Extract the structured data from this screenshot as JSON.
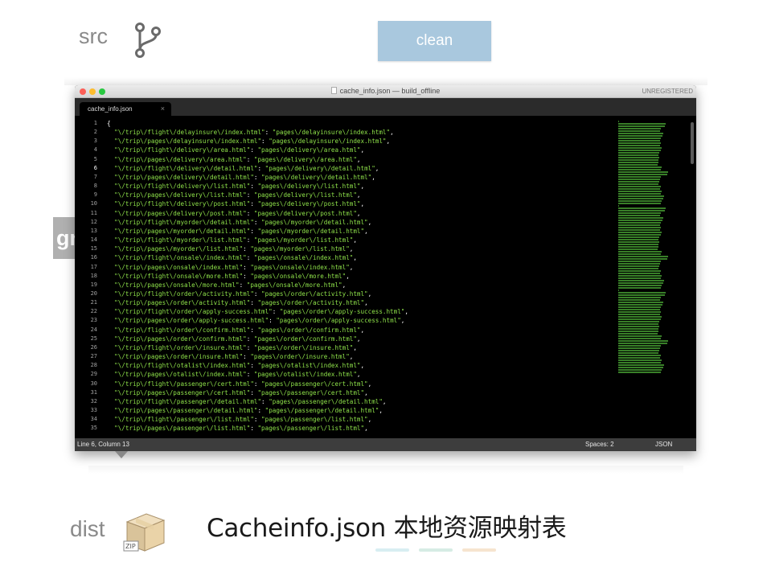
{
  "labels": {
    "src": "src",
    "dist": "dist",
    "gr_tab": "gr"
  },
  "clean_button": {
    "label": "clean"
  },
  "window": {
    "title": "cache_info.json — build_offline",
    "unregistered": "UNREGISTERED",
    "tab": "cache_info.json",
    "tab_close": "×",
    "status_position": "Line 6, Column 13",
    "status_spaces": "Spaces: 2",
    "status_syntax": "JSON"
  },
  "code_lines": [
    "{",
    "  \"\\/trip\\/flight\\/delayinsure\\/index.html\": \"pages\\/delayinsure\\/index.html\",",
    "  \"\\/trip\\/pages\\/delayinsure\\/index.html\": \"pages\\/delayinsure\\/index.html\",",
    "  \"\\/trip\\/flight\\/delivery\\/area.html\": \"pages\\/delivery\\/area.html\",",
    "  \"\\/trip\\/pages\\/delivery\\/area.html\": \"pages\\/delivery\\/area.html\",",
    "  \"\\/trip\\/flight\\/delivery\\/detail.html\": \"pages\\/delivery\\/detail.html\",",
    "  \"\\/trip\\/pages\\/delivery\\/detail.html\": \"pages\\/delivery\\/detail.html\",",
    "  \"\\/trip\\/flight\\/delivery\\/list.html\": \"pages\\/delivery\\/list.html\",",
    "  \"\\/trip\\/pages\\/delivery\\/list.html\": \"pages\\/delivery\\/list.html\",",
    "  \"\\/trip\\/flight\\/delivery\\/post.html\": \"pages\\/delivery\\/post.html\",",
    "  \"\\/trip\\/pages\\/delivery\\/post.html\": \"pages\\/delivery\\/post.html\",",
    "  \"\\/trip\\/flight\\/myorder\\/detail.html\": \"pages\\/myorder\\/detail.html\",",
    "  \"\\/trip\\/pages\\/myorder\\/detail.html\": \"pages\\/myorder\\/detail.html\",",
    "  \"\\/trip\\/flight\\/myorder\\/list.html\": \"pages\\/myorder\\/list.html\",",
    "  \"\\/trip\\/pages\\/myorder\\/list.html\": \"pages\\/myorder\\/list.html\",",
    "  \"\\/trip\\/flight\\/onsale\\/index.html\": \"pages\\/onsale\\/index.html\",",
    "  \"\\/trip\\/pages\\/onsale\\/index.html\": \"pages\\/onsale\\/index.html\",",
    "  \"\\/trip\\/flight\\/onsale\\/more.html\": \"pages\\/onsale\\/more.html\",",
    "  \"\\/trip\\/pages\\/onsale\\/more.html\": \"pages\\/onsale\\/more.html\",",
    "  \"\\/trip\\/flight\\/order\\/activity.html\": \"pages\\/order\\/activity.html\",",
    "  \"\\/trip\\/pages\\/order\\/activity.html\": \"pages\\/order\\/activity.html\",",
    "  \"\\/trip\\/flight\\/order\\/apply-success.html\": \"pages\\/order\\/apply-success.html\",",
    "  \"\\/trip\\/pages\\/order\\/apply-success.html\": \"pages\\/order\\/apply-success.html\",",
    "  \"\\/trip\\/flight\\/order\\/confirm.html\": \"pages\\/order\\/confirm.html\",",
    "  \"\\/trip\\/pages\\/order\\/confirm.html\": \"pages\\/order\\/confirm.html\",",
    "  \"\\/trip\\/flight\\/order\\/insure.html\": \"pages\\/order\\/insure.html\",",
    "  \"\\/trip\\/pages\\/order\\/insure.html\": \"pages\\/order\\/insure.html\",",
    "  \"\\/trip\\/flight\\/otalist\\/index.html\": \"pages\\/otalist\\/index.html\",",
    "  \"\\/trip\\/pages\\/otalist\\/index.html\": \"pages\\/otalist\\/index.html\",",
    "  \"\\/trip\\/flight\\/passenger\\/cert.html\": \"pages\\/passenger\\/cert.html\",",
    "  \"\\/trip\\/pages\\/passenger\\/cert.html\": \"pages\\/passenger\\/cert.html\",",
    "  \"\\/trip\\/flight\\/passenger\\/detail.html\": \"pages\\/passenger\\/detail.html\",",
    "  \"\\/trip\\/pages\\/passenger\\/detail.html\": \"pages\\/passenger\\/detail.html\",",
    "  \"\\/trip\\/flight\\/passenger\\/list.html\": \"pages\\/passenger\\/list.html\",",
    "  \"\\/trip\\/pages\\/passenger\\/list.html\": \"pages\\/passenger\\/list.html\","
  ],
  "caption": "Cacheinfo.json 本地资源映射表",
  "icons": {
    "git": "git-branch-icon",
    "zip": "zip-box-icon"
  },
  "colors": {
    "clean_button": "#a9c8de",
    "string": "#8fe34a",
    "caption_bars": [
      "#d8eef2",
      "#d6ece4",
      "#f6e4cf"
    ]
  }
}
